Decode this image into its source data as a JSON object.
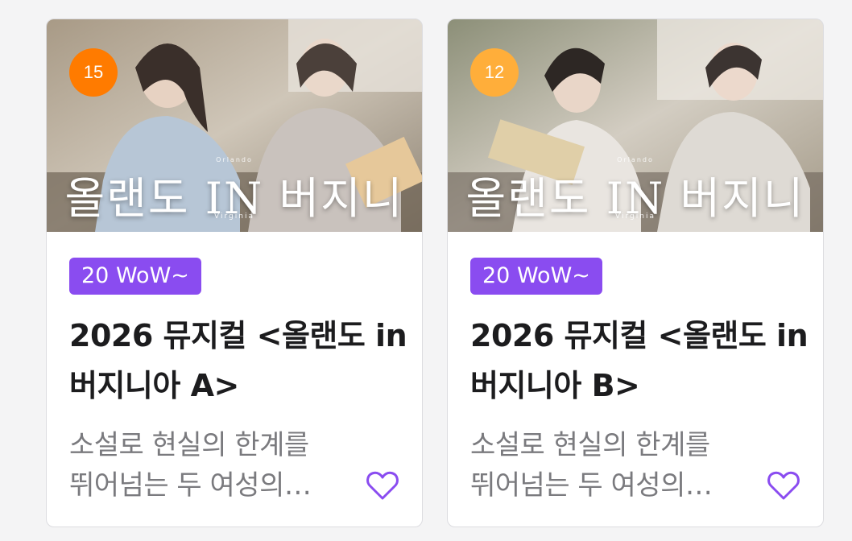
{
  "cards": [
    {
      "age_rating": "15",
      "age_color": "#ff7b00",
      "poster_title": "올랜도 IN 버지니아",
      "poster_sub_top": "Orlando",
      "poster_sub": "Virginia",
      "tag": "20 WoW~",
      "title_line1": "2026 뮤지컬 <올랜도 in",
      "title_line2": "버지니아 A>",
      "desc_line1": "소설로 현실의 한계를",
      "desc_line2": "뛰어넘는 두 여성의…",
      "icon": "heart-outline"
    },
    {
      "age_rating": "12",
      "age_color": "#ffae3a",
      "poster_title": "올랜도 IN 버지니아",
      "poster_sub_top": "Orlando",
      "poster_sub": "Virginia",
      "tag": "20 WoW~",
      "title_line1": "2026 뮤지컬 <올랜도 in",
      "title_line2": "버지니아 B>",
      "desc_line1": "소설로 현실의 한계를",
      "desc_line2": "뛰어넘는 두 여성의…",
      "icon": "heart-outline"
    }
  ],
  "colors": {
    "tag_bg": "#8a4cf0",
    "heart": "#8a4cf0"
  }
}
